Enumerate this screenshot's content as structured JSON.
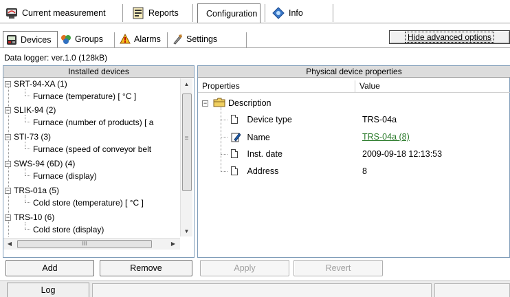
{
  "top_tabs": [
    {
      "label": "Current measurement",
      "icon": "gauge-icon"
    },
    {
      "label": "Reports",
      "icon": "report-icon"
    },
    {
      "label": "Configuration",
      "icon": "configuration-icon",
      "active": true
    },
    {
      "label": "Info",
      "icon": "info-icon"
    }
  ],
  "sub_tabs": [
    {
      "label": "Devices",
      "icon": "device-icon",
      "active": true
    },
    {
      "label": "Groups",
      "icon": "groups-icon"
    },
    {
      "label": "Alarms",
      "icon": "alarm-icon"
    },
    {
      "label": "Settings",
      "icon": "settings-icon"
    }
  ],
  "advanced_button": "Hide advanced options",
  "logger_info": "Data logger: ver.1.0 (128kB)",
  "installed_devices": {
    "header": "Installed devices",
    "items": [
      {
        "device": "SRT-94-XA (1)",
        "child": "Furnace (temperature) [ °C ]"
      },
      {
        "device": "SLIK-94 (2)",
        "child": "Furnace (number of products) [ a"
      },
      {
        "device": "STI-73 (3)",
        "child": "Furnace (speed of conveyor belt"
      },
      {
        "device": "SWS-94 (6D) (4)",
        "child": "Furnace (display)"
      },
      {
        "device": "TRS-01a (5)",
        "child": "Cold store (temperature) [ °C ]"
      },
      {
        "device": "TRS-10 (6)",
        "child": "Cold store (display)"
      }
    ],
    "scroll_h_thumb": "III",
    "add_label": "Add",
    "remove_label": "Remove"
  },
  "properties": {
    "header": "Physical device properties",
    "col_properties": "Properties",
    "col_value": "Value",
    "group": "Description",
    "rows": [
      {
        "name": "Device type",
        "value": "TRS-04a",
        "icon": "document-icon"
      },
      {
        "name": "Name",
        "value": "TRS-04a (8)",
        "icon": "edit-document-icon",
        "link": true
      },
      {
        "name": "Inst. date",
        "value": "2009-09-18 12:13:53",
        "icon": "document-icon"
      },
      {
        "name": "Address",
        "value": "8",
        "icon": "document-icon"
      }
    ],
    "apply_label": "Apply",
    "revert_label": "Revert"
  },
  "bottom": {
    "log_label": "Log"
  }
}
